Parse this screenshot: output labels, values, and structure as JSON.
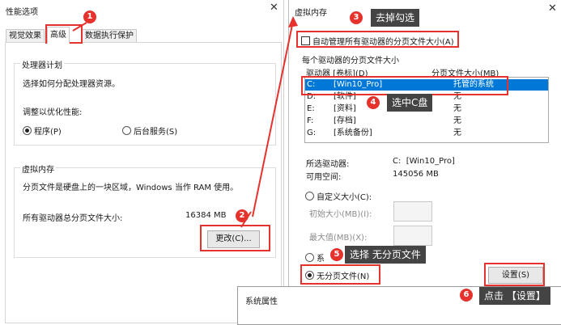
{
  "left_window": {
    "title": "性能选项",
    "tabs": [
      "视觉效果",
      "高级",
      "数据执行保护"
    ],
    "processor": {
      "group_label": "处理器计划",
      "description": "选择如何分配处理器资源。",
      "optimize_label": "调整以优化性能:",
      "option_programs": "程序(P)",
      "option_services": "后台服务(S)"
    },
    "virtual_memory": {
      "group_label": "虚拟内存",
      "description": "分页文件是硬盘上的一块区域，Windows 当作 RAM 使用。",
      "total_label": "所有驱动器总分页文件大小:",
      "total_value": "16384 MB",
      "change_button": "更改(C)..."
    }
  },
  "right_window": {
    "title": "虚拟内存",
    "auto_manage_label": "自动管理所有驱动器的分页文件大小(A)",
    "per_drive_group": "每个驱动器的分页文件大小",
    "col_drive": "驱动器 [卷标](D)",
    "col_size": "分页文件大小(MB)",
    "drives": [
      {
        "letter": "C:",
        "label": "[Win10_Pro]",
        "size": "托管的系统"
      },
      {
        "letter": "D:",
        "label": "[软件]",
        "size": "无"
      },
      {
        "letter": "E:",
        "label": "[资料]",
        "size": "无"
      },
      {
        "letter": "F:",
        "label": "[存档]",
        "size": "无"
      },
      {
        "letter": "G:",
        "label": "[系统备份]",
        "size": "无"
      }
    ],
    "selected_drive_label": "所选驱动器:",
    "selected_drive_value": "C:  [Win10_Pro]",
    "free_space_label": "可用空间:",
    "free_space_value": "145056 MB",
    "custom_size_label": "自定义大小(C):",
    "initial_size_label": "初始大小(MB)(I):",
    "max_size_label": "最大值(MB)(X):",
    "system_managed_label": "系",
    "no_paging_label": "无分页文件(N)",
    "set_button": "设置(S)"
  },
  "bottom_window": {
    "title": "系统属性"
  },
  "annotations": [
    {
      "num": "1"
    },
    {
      "num": "2"
    },
    {
      "num": "3",
      "text": "去掉勾选"
    },
    {
      "num": "4",
      "text": "选中C盘"
    },
    {
      "num": "5",
      "text": "选择 无分页文件"
    },
    {
      "num": "6",
      "text": "点击 【设置】"
    }
  ],
  "colors": {
    "annotation_red": "#e5322d",
    "tooltip_bg": "#444444",
    "selection_blue": "#0078d7"
  }
}
